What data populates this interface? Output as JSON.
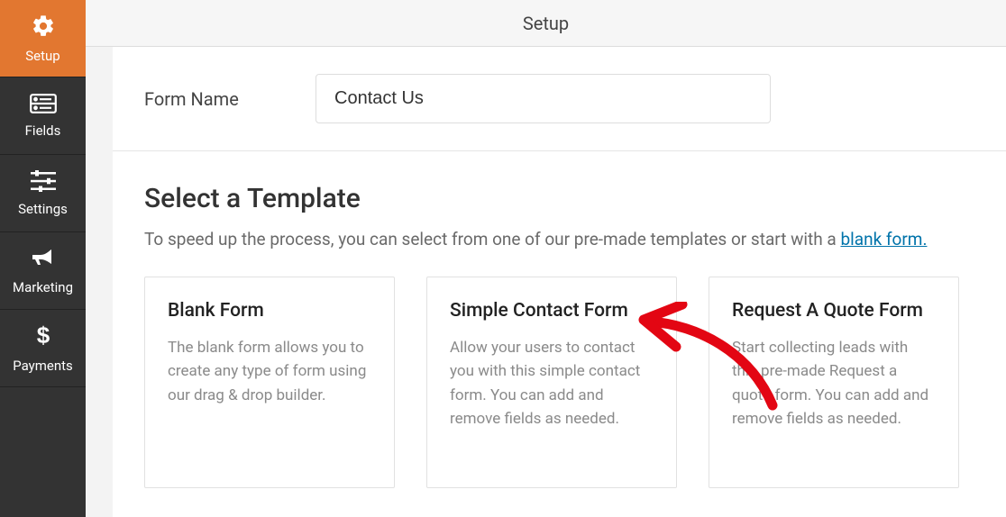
{
  "header": {
    "title": "Setup"
  },
  "sidebar": {
    "items": [
      {
        "label": "Setup"
      },
      {
        "label": "Fields"
      },
      {
        "label": "Settings"
      },
      {
        "label": "Marketing"
      },
      {
        "label": "Payments"
      }
    ]
  },
  "form_name": {
    "label": "Form Name",
    "value": "Contact Us"
  },
  "templates_section": {
    "heading": "Select a Template",
    "lead_prefix": "To speed up the process, you can select from one of our pre-made templates or start with a ",
    "lead_link": "blank form."
  },
  "templates": [
    {
      "title": "Blank Form",
      "desc": "The blank form allows you to create any type of form using our drag & drop builder."
    },
    {
      "title": "Simple Contact Form",
      "desc": "Allow your users to contact you with this simple contact form. You can add and remove fields as needed."
    },
    {
      "title": "Request A Quote Form",
      "desc": "Start collecting leads with this pre-made Request a quote form. You can add and remove fields as needed."
    }
  ]
}
